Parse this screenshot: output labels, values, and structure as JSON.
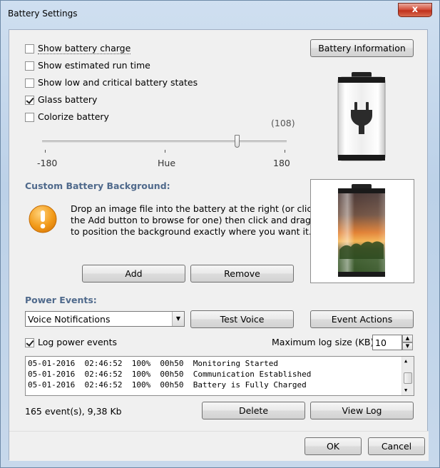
{
  "window": {
    "title": "Battery Settings",
    "close_label": "x"
  },
  "options": {
    "show_battery_charge": {
      "label": "Show battery charge",
      "checked": false
    },
    "show_run_time": {
      "label": "Show estimated run time",
      "checked": false
    },
    "show_low_states": {
      "label": "Show low and critical battery states",
      "checked": false
    },
    "glass_battery": {
      "label": "Glass battery",
      "checked": true
    },
    "colorize_battery": {
      "label": "Colorize battery",
      "checked": false
    }
  },
  "battery_info_button": "Battery Information",
  "hue": {
    "value_display": "(108)",
    "value": 108,
    "min": -180,
    "max": 180,
    "min_label": "-180",
    "mid_label": "Hue",
    "max_label": "180"
  },
  "custom_background": {
    "title": "Custom Battery Background:",
    "description_line1": "Drop an image file into the battery at the right (or click",
    "description_line2": "the Add button to browse for one) then click and drag",
    "description_line3": "to position the background exactly where you want it.",
    "add_button": "Add",
    "remove_button": "Remove"
  },
  "power_events": {
    "title": "Power Events:",
    "voice_select": "Voice Notifications",
    "test_voice_button": "Test Voice",
    "event_actions_button": "Event Actions",
    "log_checkbox": {
      "label": "Log power events",
      "checked": true
    },
    "max_log_label": "Maximum log size (KB):",
    "max_log_value": "10",
    "log_entries": [
      "05-01-2016  02:46:52  100%  00h50  Monitoring Started",
      "05-01-2016  02:46:52  100%  00h50  Communication Established",
      "05-01-2016  02:46:52  100%  00h50  Battery is Fully Charged"
    ],
    "event_count": "165 event(s), 9,38 Kb",
    "delete_button": "Delete",
    "view_log_button": "View Log"
  },
  "footer": {
    "ok_button": "OK",
    "cancel_button": "Cancel"
  },
  "colors": {
    "section_title": "#506a8c",
    "warning_orange": "#f29b1a"
  },
  "icons": {
    "warning": "warning-icon",
    "battery_plug": "battery-plug-icon",
    "battery_sunset": "battery-sunset-preview"
  }
}
